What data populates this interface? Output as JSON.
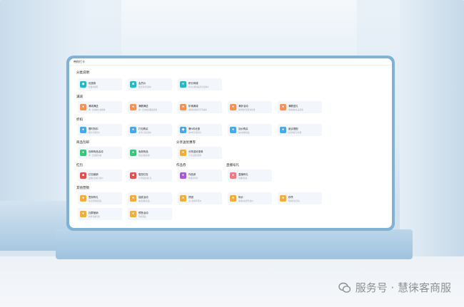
{
  "window": {
    "title": "带你打卡"
  },
  "watermark": {
    "text": "服务号 · 慧徕客商服"
  },
  "colors": {
    "teal": "#25b9c6",
    "orange": "#f2935a",
    "blue": "#4aa8e8",
    "green": "#3cc47c",
    "red": "#e1504e",
    "purple": "#a55bd7",
    "pink": "#ee7a85",
    "amber": "#f2ad3c"
  },
  "sections": {
    "s1": "分类说明",
    "s2": "满减",
    "s3": "折扣",
    "s4": "商品包邮",
    "s5": "分享送优惠券",
    "s6": "红包",
    "s7": "作品券",
    "s8": "直播号礼",
    "s9": "其他营销"
  },
  "cards": {
    "c1": {
      "title": "优惠券",
      "sub": "优惠券说明",
      "icon": "tag-icon"
    },
    "c2": {
      "title": "会员价",
      "sub": "会员专享优惠价",
      "icon": "member-icon"
    },
    "c3": {
      "title": "积分商城",
      "sub": "积分兑换商品专享优惠价",
      "icon": "points-icon"
    },
    "c4": {
      "title": "满减满送",
      "sub": "满一定金额立减金额",
      "icon": "cart-icon"
    },
    "c5": {
      "title": "满额满送",
      "sub": "满一定金额送赠品优惠",
      "icon": "gift-icon"
    },
    "c6": {
      "title": "阶梯满减",
      "sub": "满阶梯金额享不同减免",
      "icon": "steps-icon"
    },
    "c7": {
      "title": "满折活动",
      "sub": "满件数享受折扣优惠",
      "icon": "percent-icon"
    },
    "c8": {
      "title": "满额送礼",
      "sub": "满金额送礼品活动",
      "icon": "box-icon"
    },
    "c9": {
      "title": "限时折扣",
      "sub": "限时享受折扣",
      "icon": "clock-icon"
    },
    "c10": {
      "title": "打包购买",
      "sub": "多件打包优惠价",
      "icon": "pack-icon"
    },
    "c11": {
      "title": "第N件优惠",
      "sub": "第N件享受折扣",
      "icon": "discount-icon"
    },
    "c12": {
      "title": "加价购买",
      "sub": "加价换购商品",
      "icon": "plus-icon"
    },
    "c13": {
      "title": "组合搭配",
      "sub": "组合购买享优惠",
      "icon": "combo-icon"
    },
    "c14": {
      "title": "包邮商品活动",
      "sub": "满一定金额包邮",
      "icon": "truck-icon"
    },
    "c15": {
      "title": "免邮商品",
      "sub": "指定商品免邮",
      "icon": "ship-icon"
    },
    "c16": {
      "title": "分享送优惠券",
      "sub": "分享后送优惠券",
      "icon": "share-icon"
    },
    "c17": {
      "title": "红包营销",
      "sub": "发放红包吸引用户",
      "icon": "redpacket-icon"
    },
    "c18": {
      "title": "裂变红包",
      "sub": "分享裂变领红包",
      "icon": "split-icon"
    },
    "c19": {
      "title": "作品券",
      "sub": "作品专享券",
      "icon": "ticket-icon"
    },
    "c20": {
      "title": "直播有礼",
      "sub": "直播间送礼",
      "icon": "live-icon"
    },
    "c21": {
      "title": "签到有礼",
      "sub": "每日签到领奖励",
      "icon": "calendar-icon"
    },
    "c22": {
      "title": "抽奖活动",
      "sub": "抽奖赢取奖品",
      "icon": "lottery-icon"
    },
    "c23": {
      "title": "拼团",
      "sub": "多人拼团享低价",
      "icon": "group-icon"
    },
    "c24": {
      "title": "砍价",
      "sub": "邀请好友帮忙砍价",
      "icon": "knife-icon"
    },
    "c25": {
      "title": "秒杀",
      "sub": "限时秒杀活动",
      "icon": "flash-icon"
    },
    "c26": {
      "title": "社群营销",
      "sub": "社群专属优惠",
      "icon": "chat-icon"
    },
    "c27": {
      "title": "预售活动",
      "sub": "预售商品",
      "icon": "presale-icon"
    }
  }
}
